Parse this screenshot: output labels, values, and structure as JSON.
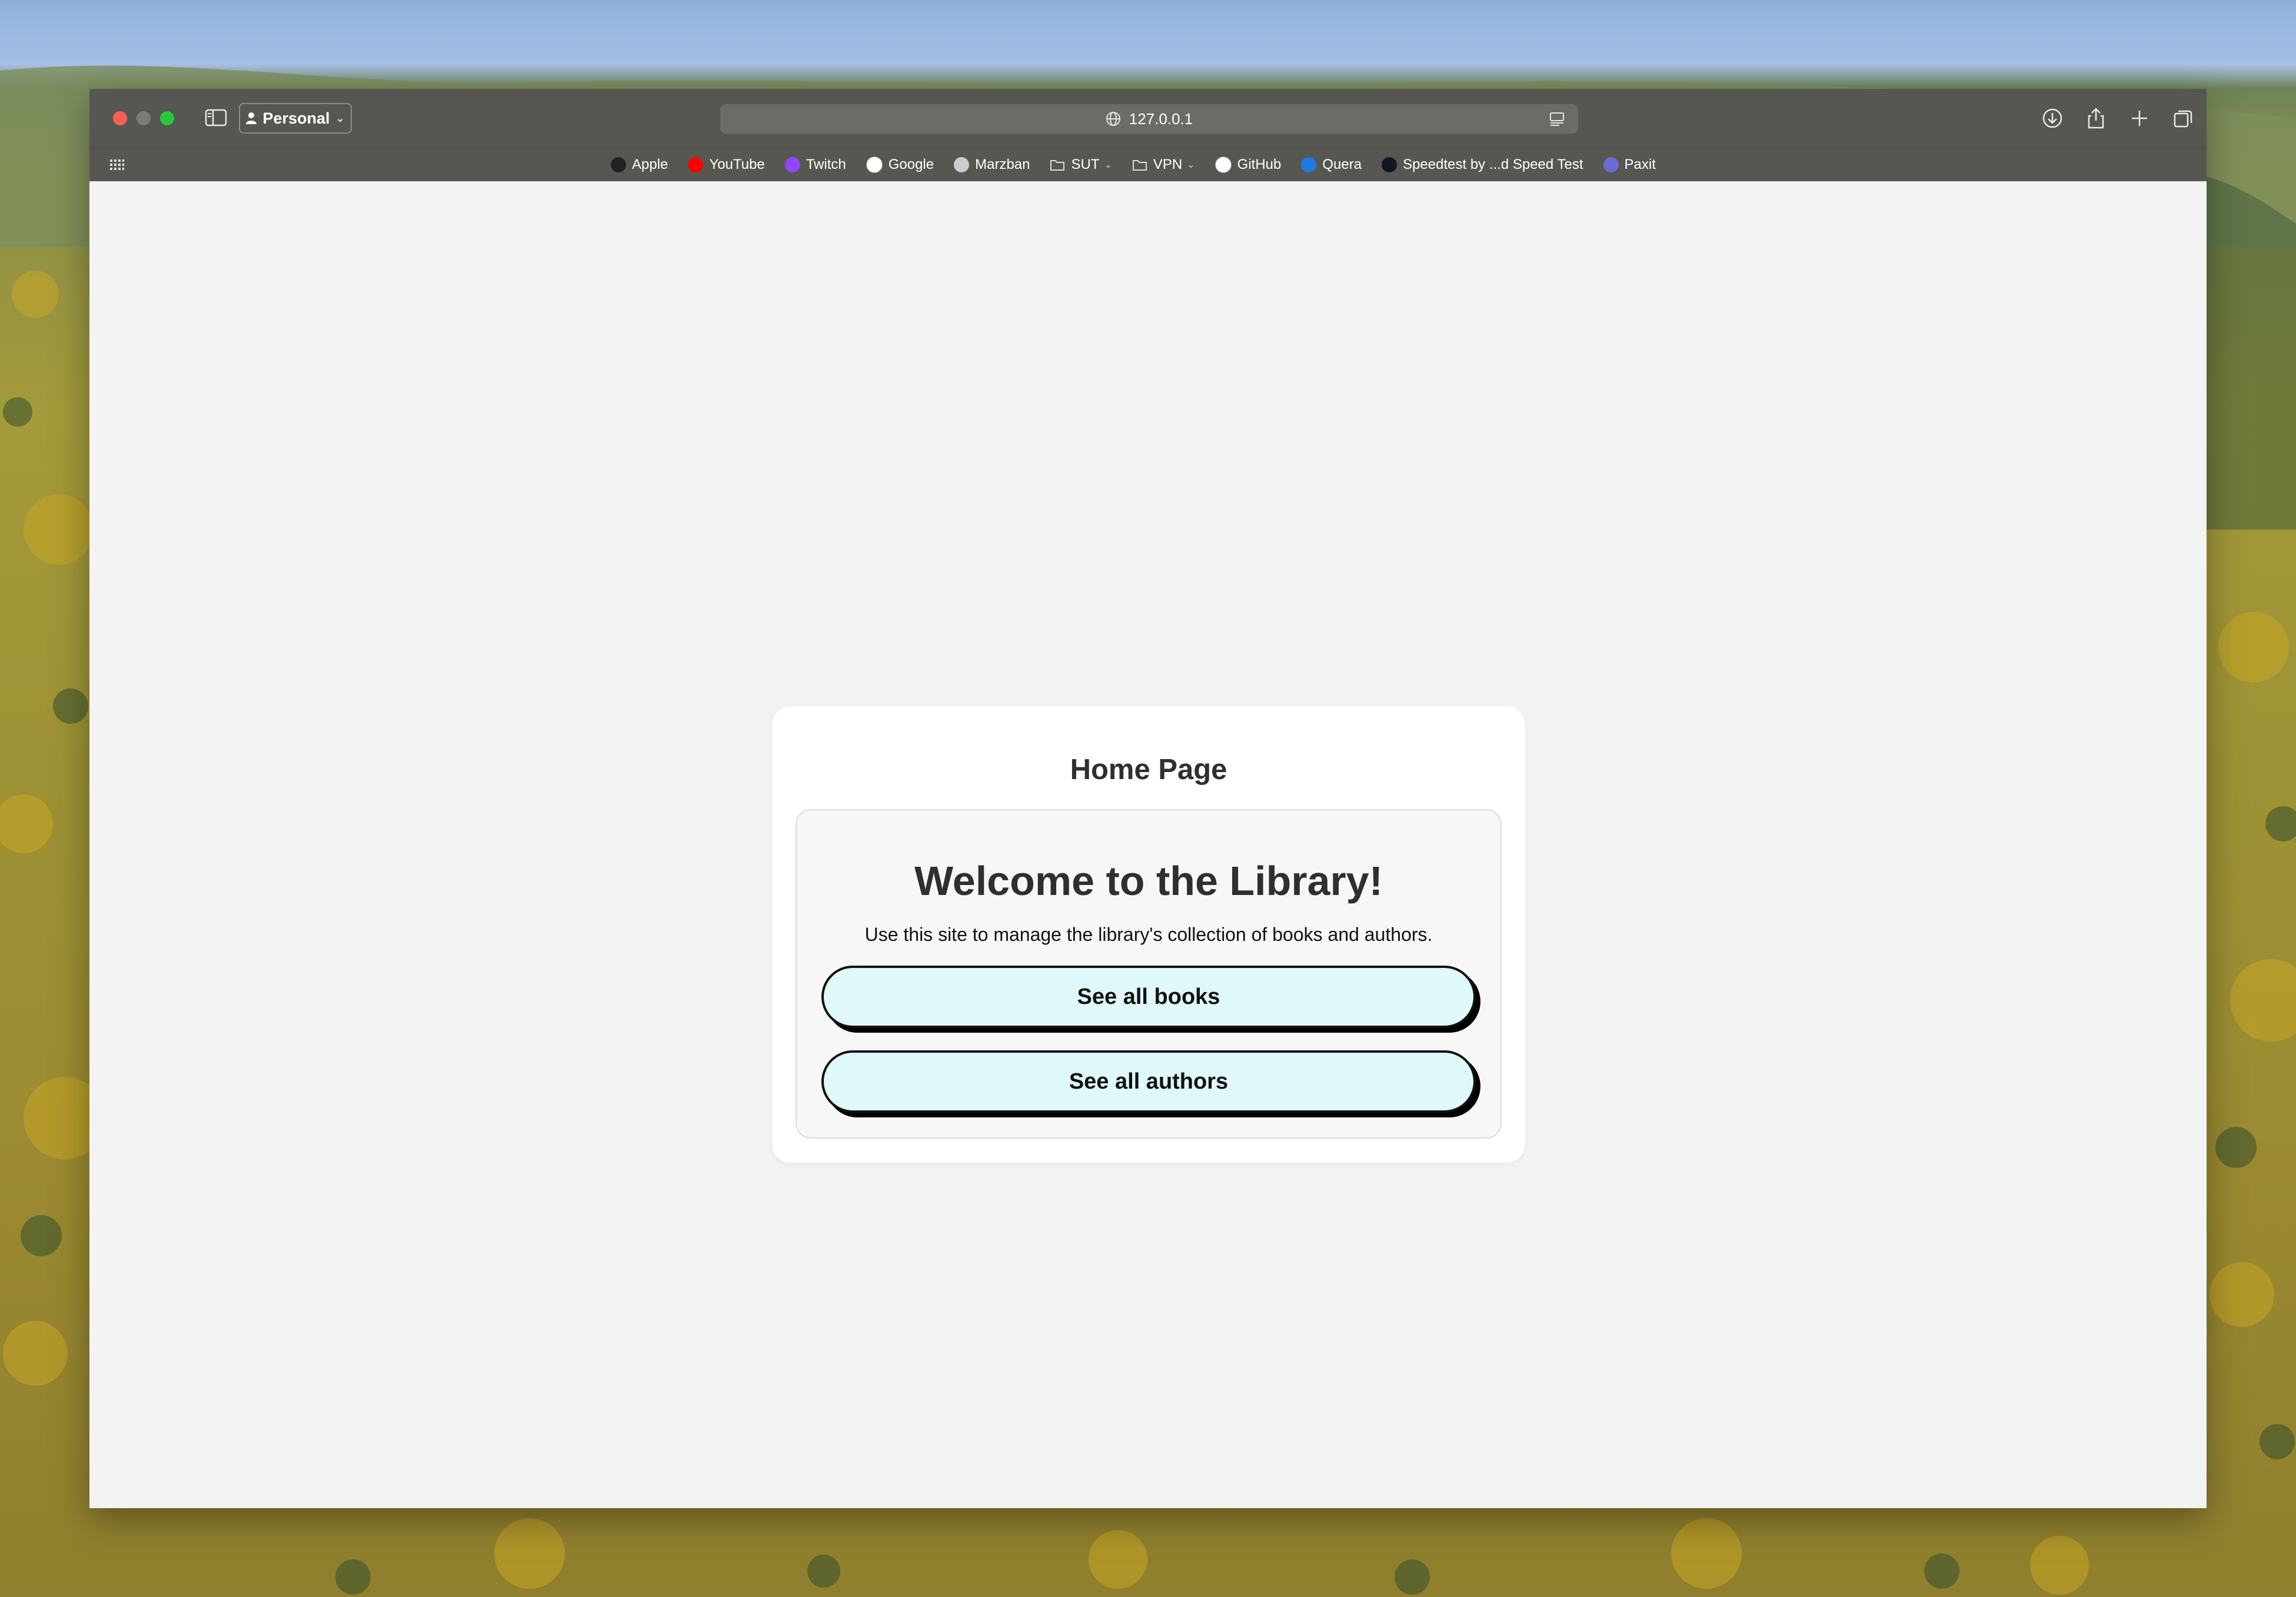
{
  "browser": {
    "profile_label": "Personal",
    "url": "127.0.0.1",
    "bookmarks": [
      {
        "label": "Apple",
        "icon": "apple-icon",
        "color": "#222222"
      },
      {
        "label": "YouTube",
        "icon": "youtube-icon",
        "color": "#ff0000"
      },
      {
        "label": "Twitch",
        "icon": "twitch-icon",
        "color": "#9146ff"
      },
      {
        "label": "Google",
        "icon": "google-icon",
        "color": "#ffffff"
      },
      {
        "label": "Marzban",
        "icon": "marzban-icon",
        "color": "#cccccc"
      },
      {
        "label": "SUT",
        "icon": "folder-icon",
        "folder": true
      },
      {
        "label": "VPN",
        "icon": "folder-icon",
        "folder": true
      },
      {
        "label": "GitHub",
        "icon": "github-icon",
        "color": "#ffffff"
      },
      {
        "label": "Quera",
        "icon": "quera-icon",
        "color": "#1f7ae0"
      },
      {
        "label": "Speedtest by ...d Speed Test",
        "icon": "speedtest-icon",
        "color": "#141526"
      },
      {
        "label": "Paxit",
        "icon": "paxit-icon",
        "color": "#6b6bd6"
      }
    ]
  },
  "page": {
    "card_title": "Home Page",
    "welcome": "Welcome to the Library!",
    "description": "Use this site to manage the library's collection of books and authors.",
    "books_button": "See all books",
    "authors_button": "See all authors"
  },
  "colors": {
    "button_bg": "#dff8fa",
    "titlebar": "#575752"
  }
}
